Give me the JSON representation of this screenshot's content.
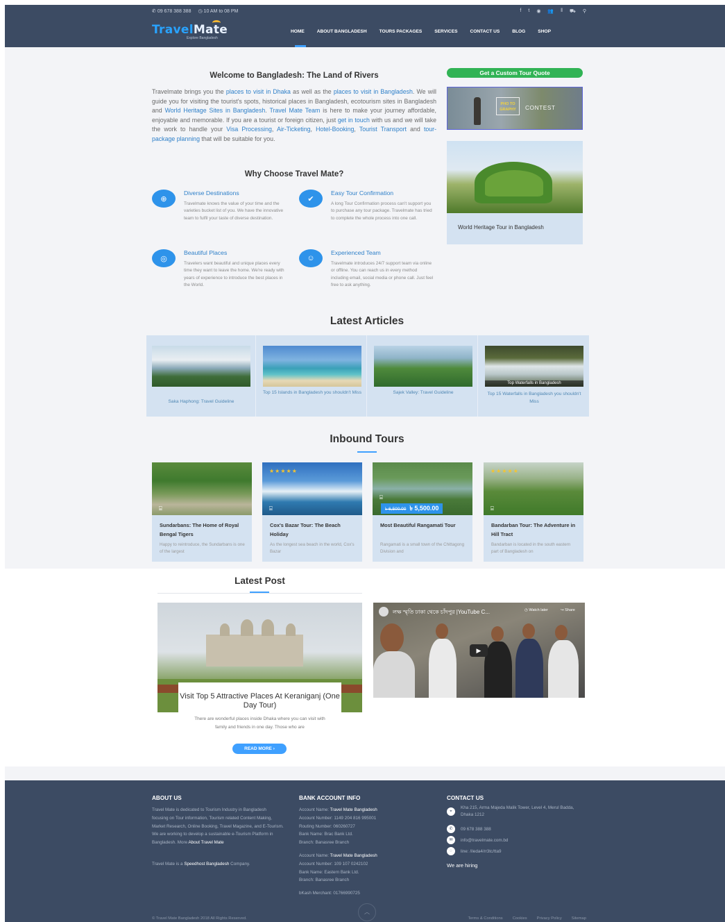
{
  "topbar": {
    "phone": "09 678 388 388",
    "hours": "10 AM to 08 PM",
    "icons": [
      "facebook-icon",
      "twitter-icon",
      "pinterest-icon",
      "user-icon",
      "menu-icon",
      "cart-icon",
      "search-icon"
    ]
  },
  "logo": {
    "main": "Travel",
    "accent": "Mate",
    "tagline": "Explore Bangladesh"
  },
  "nav": [
    "HOME",
    "ABOUT BANGLADESH",
    "TOURS PACKAGES",
    "SERVICES",
    "CONTACT US",
    "BLOG",
    "SHOP"
  ],
  "welcome": {
    "title": "Welcome to Bangladesh: The Land of Rivers",
    "p": [
      {
        "t": "Travelmate brings you the "
      },
      {
        "t": "places to visit in Dhaka",
        "l": true
      },
      {
        "t": " as well as the "
      },
      {
        "t": "places to visit in Bangladesh",
        "l": true
      },
      {
        "t": ". We will guide you for visiting the tourist's spots, historical places in Bangladesh, ecotourism sites in Bangladesh and "
      },
      {
        "t": "World Heritage Sites in Bangladesh",
        "l": true
      },
      {
        "t": ". "
      },
      {
        "t": "Travel Mate Team",
        "l": true
      },
      {
        "t": " is here to make your journey affordable, enjoyable and memorable. If you are a tourist or foreign citizen, just "
      },
      {
        "t": "get in touch",
        "l": true
      },
      {
        "t": " with us and we will take the work to handle your "
      },
      {
        "t": "Visa Processing",
        "l": true
      },
      {
        "t": ", "
      },
      {
        "t": "Air-Ticketing",
        "l": true
      },
      {
        "t": ", "
      },
      {
        "t": "Hotel-Booking",
        "l": true
      },
      {
        "t": ", "
      },
      {
        "t": "Tourist Transport",
        "l": true
      },
      {
        "t": " and "
      },
      {
        "t": "tour-package planning",
        "l": true
      },
      {
        "t": " that will be suitable for you."
      }
    ]
  },
  "why": {
    "title": "Why Choose Travel Mate?",
    "features": [
      {
        "title": "Diverse Destinations",
        "icon": "globe-icon",
        "text": "Travelmate knows the value of your time and the varieties bucket list of you. We have the innovative team to fulfil your taste of diverse destination."
      },
      {
        "title": "Easy Tour Confirmation",
        "icon": "check-icon",
        "text": "A long Tour Confirmation process can't support you to purchase any tour package. Travelmate has tried to complete the whole process into one call."
      },
      {
        "title": "Beautiful Places",
        "icon": "camera-icon",
        "text": "Travelers want beautiful and unique places every time they want to leave the home. We're ready with years of experience to introduce the best places in the World."
      },
      {
        "title": "Experienced Team",
        "icon": "chat-icon",
        "text": "Travelmate introduces 24/7 support team via online or offline. You can reach us in every method including email, social media or phone call. Just feel free to ask anything."
      }
    ]
  },
  "sidebar": {
    "quote_btn": "Get a Custom Tour Quote",
    "photo_box": "PHO TO GRAPHY",
    "photo_contest": "CONTEST",
    "heritage_caption": "World Heritage Tour in Bangladesh"
  },
  "articles": {
    "title": "Latest Articles",
    "items": [
      {
        "caption": "Saka Haphong: Travel Guideline"
      },
      {
        "caption": "Top 15 Islands in Bangladesh you shouldn't Miss"
      },
      {
        "caption": "Sajek Valley: Travel Guideline"
      },
      {
        "caption": "Top 15 Waterfalls in Bangladesh you shouldn't Miss",
        "overlay": "Top Waterfalls in Bangladesh"
      }
    ]
  },
  "tours": {
    "title": "Inbound Tours",
    "items": [
      {
        "title": "Sundarbans: The Home of Royal Bengal Tigers",
        "text": "Happy to reintroduce, the Sundarbans is one of the largest",
        "stars": ""
      },
      {
        "title": "Cox's Bazar Tour: The Beach Holiday",
        "text": "As the longest sea beach in the world, Cox's Bazar",
        "stars": "★★★★★"
      },
      {
        "title": "Most Beautiful Rangamati Tour",
        "text": "Rangamati is a small town of the Chittagong Division and",
        "stars": "",
        "old_price": "৳ 6,500.00",
        "price": "৳ 5,500.00"
      },
      {
        "title": "Bandarban Tour: The Adventure in Hill Tract",
        "text": "Bandarban is located in the south eastern part of Bangladesh on",
        "stars": "★★★★★"
      }
    ]
  },
  "latest_post": {
    "title": "Latest Post",
    "post_title": "Visit Top 5 Attractive Places At Keraniganj (One Day Tour)",
    "post_text": "There are wonderful places inside Dhaka where you can visit with family and friends in one day. Those who are",
    "read_more": "READ MORE",
    "video_title": "লক্ষ স্মৃতি ঢাকা থেকে চাঁদপুর |YouTube C...",
    "video_watch_later": "Watch later",
    "video_share": "Share"
  },
  "footer": {
    "about_title": "ABOUT US",
    "about_text_1": "Travel Mate is dedicated to Tourism Industry in Bangladesh focusing on Tour information, Tourism related Content Making, Market Research, Online Booking, Travel Magazine, and E-Tourism. We are working to develop a sustainable e-Tourism Platform in Bangladesh. More ",
    "about_link": "About Travel Mate",
    "about_text_2a": "Travel Mate is a ",
    "about_link_2": "Speedhost Bangladesh",
    "about_text_2b": " Company.",
    "bank_title": "BANK ACCOUNT INFO",
    "bank1": [
      "Account Name: ",
      "Travel Mate Bangladesh",
      "Account Number: 1149 204 816 995001",
      "Routing Number: 060260727",
      "Bank Name: Brac Bank Ltd.",
      "Branch: Banasree Branch"
    ],
    "bank2": [
      "Account Name: ",
      "Travel Mate Bangladesh",
      "Account Number: 109 107 0242102",
      "Bank Name: Eastern Bank Ltd.",
      "Branch: Banasree Branch"
    ],
    "bkash": "bKash Merchant: 01766990725",
    "contact_title": "CONTACT US",
    "address": "Kha 215, Arma Majeda Malik Tower, Level 4, Merul Badda, Dhaka 1212",
    "phone": "09 678 388 388",
    "email": "info@travelmate.com.bd",
    "line": "line: /ileda4/rr3tc/tta9",
    "hiring": "We are hiring",
    "copyright": "© Travel Mate Bangladesh 2018 All Rights Reserved.",
    "links": [
      "Terms & Conditions",
      "Cookies",
      "Privacy Policy",
      "Sitemap"
    ]
  }
}
